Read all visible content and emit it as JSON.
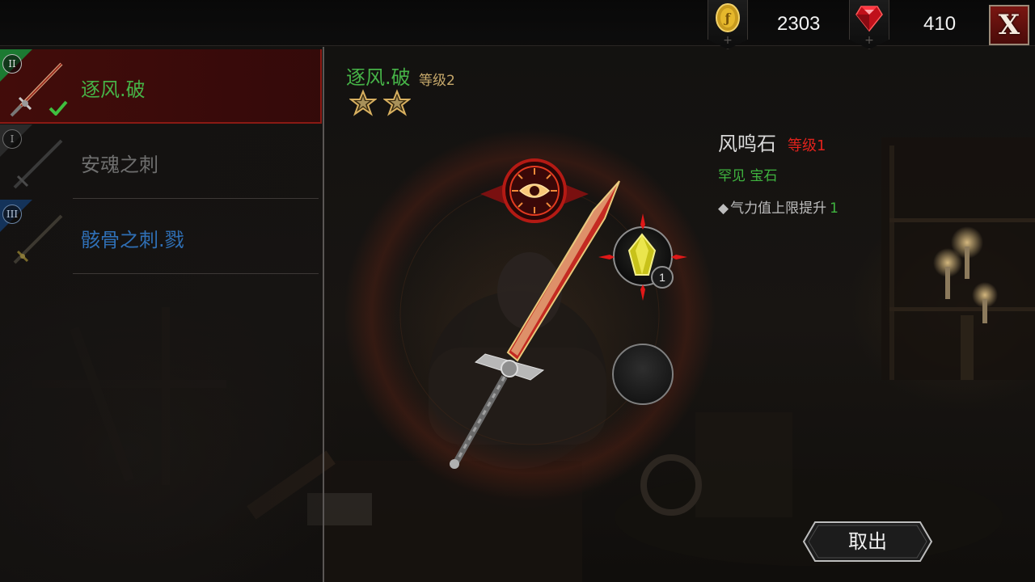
{
  "currency": {
    "gold": {
      "icon": "gold-coin-icon",
      "value": "2303"
    },
    "gem": {
      "icon": "red-gem-icon",
      "value": "410"
    },
    "add_symbol": "+"
  },
  "close_button": {
    "label": "X"
  },
  "weapons": [
    {
      "name": "逐风.破",
      "tier": "II",
      "color": "#4bb543",
      "selected": true,
      "equipped": true
    },
    {
      "name": "安魂之刺",
      "tier": "I",
      "color": "#6e6e6e",
      "selected": false,
      "equipped": false
    },
    {
      "name": "骸骨之刺.戮",
      "tier": "III",
      "color": "#2f6fb5",
      "selected": false,
      "equipped": false
    }
  ],
  "selected_weapon": {
    "name": "逐风.破",
    "level_label": "等级2",
    "stars": 2
  },
  "gem_info": {
    "name": "风鸣石",
    "level_label": "等级1",
    "rarity": "罕见 宝石",
    "bonus_bullet": "◆",
    "bonus_text": "气力值上限提升",
    "bonus_value": "1"
  },
  "socket": {
    "gem_count": "1"
  },
  "actions": {
    "take_out": "取出"
  },
  "colors": {
    "accent_red": "#8a1a14",
    "green": "#46b347",
    "blue": "#2f6fb5",
    "gold": "#c6a86a"
  }
}
